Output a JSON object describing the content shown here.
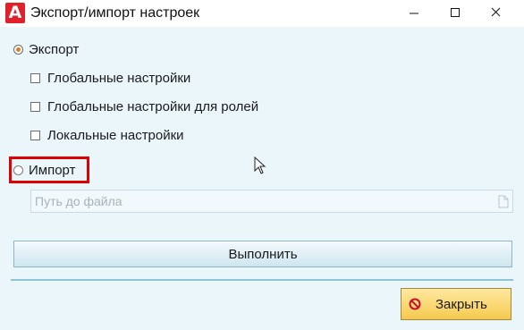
{
  "window": {
    "title": "Экспорт/импорт настроек",
    "app_icon_letter": "A"
  },
  "export": {
    "label": "Экспорт",
    "selected": true,
    "options": [
      {
        "label": "Глобальные настройки",
        "checked": false
      },
      {
        "label": "Глобальные настройки для ролей",
        "checked": false
      },
      {
        "label": "Локальные настройки",
        "checked": false
      }
    ]
  },
  "import": {
    "label": "Импорт",
    "selected": false,
    "path_placeholder": "Путь до файла",
    "path_value": ""
  },
  "actions": {
    "run_label": "Выполнить",
    "close_label": "Закрыть"
  },
  "colors": {
    "background": "#eaf6fa",
    "accent_orange": "#e87a1e",
    "highlight_red": "#e00000",
    "close_button": "#f5c94e",
    "separator": "#8ec5d6"
  },
  "icons": [
    "minimize-icon",
    "maximize-icon",
    "close-window-icon",
    "file-icon",
    "no-entry-icon",
    "mouse-cursor-icon"
  ]
}
